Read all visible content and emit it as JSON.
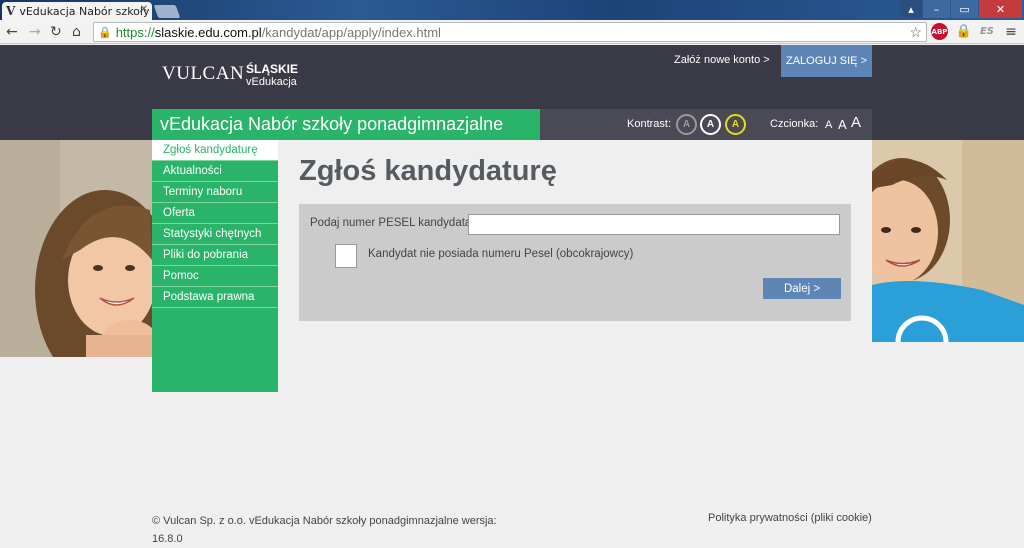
{
  "browser": {
    "tab_title": "vEdukacja Nabór szkoły p",
    "tab_favicon": "V",
    "url_protocol": "https://",
    "url_host": "slaskie.edu.com.pl",
    "url_path": "/kandydat/app/apply/index.html",
    "ext_abp": "ABP",
    "ext_es": "ES"
  },
  "header": {
    "logo_vulcan": "VULCAN",
    "logo_region": "ŚLĄSKIE",
    "logo_region_sub": "vEdukacja",
    "signup_link": "Załóż nowe konto >",
    "login_button": "ZALOGUJ SIĘ >",
    "app_title": "vEdukacja Nabór szkoły ponadgimnazjalne",
    "contrast_label": "Kontrast:",
    "contrast_options": [
      "A",
      "A",
      "A"
    ],
    "font_label": "Czcionka:",
    "font_options": [
      "A",
      "A",
      "A"
    ]
  },
  "sidebar": {
    "items": [
      {
        "label": "Zgłoś kandydaturę",
        "active": true
      },
      {
        "label": "Aktualności"
      },
      {
        "label": "Terminy naboru"
      },
      {
        "label": "Oferta"
      },
      {
        "label": "Statystyki chętnych"
      },
      {
        "label": "Pliki do pobrania"
      },
      {
        "label": "Pomoc"
      },
      {
        "label": "Podstawa prawna"
      }
    ]
  },
  "main": {
    "title": "Zgłoś kandydaturę",
    "pesel_label": "Podaj numer PESEL kandydata:",
    "pesel_value": "",
    "no_pesel_label": "Kandydat nie posiada numeru Pesel (obcokrajowcy)",
    "next_button": "Dalej >"
  },
  "footer": {
    "copyright": "© Vulcan Sp. z o.o. vEdukacja Nabór szkoły ponadgimnazjalne wersja:",
    "version": "16.8.0",
    "privacy_link": "Polityka prywatności (pliki cookie)"
  },
  "colors": {
    "green": "#2ab46a",
    "header_dark": "#3a3a46",
    "button_blue": "#5d86b6",
    "background": "#efefef"
  }
}
